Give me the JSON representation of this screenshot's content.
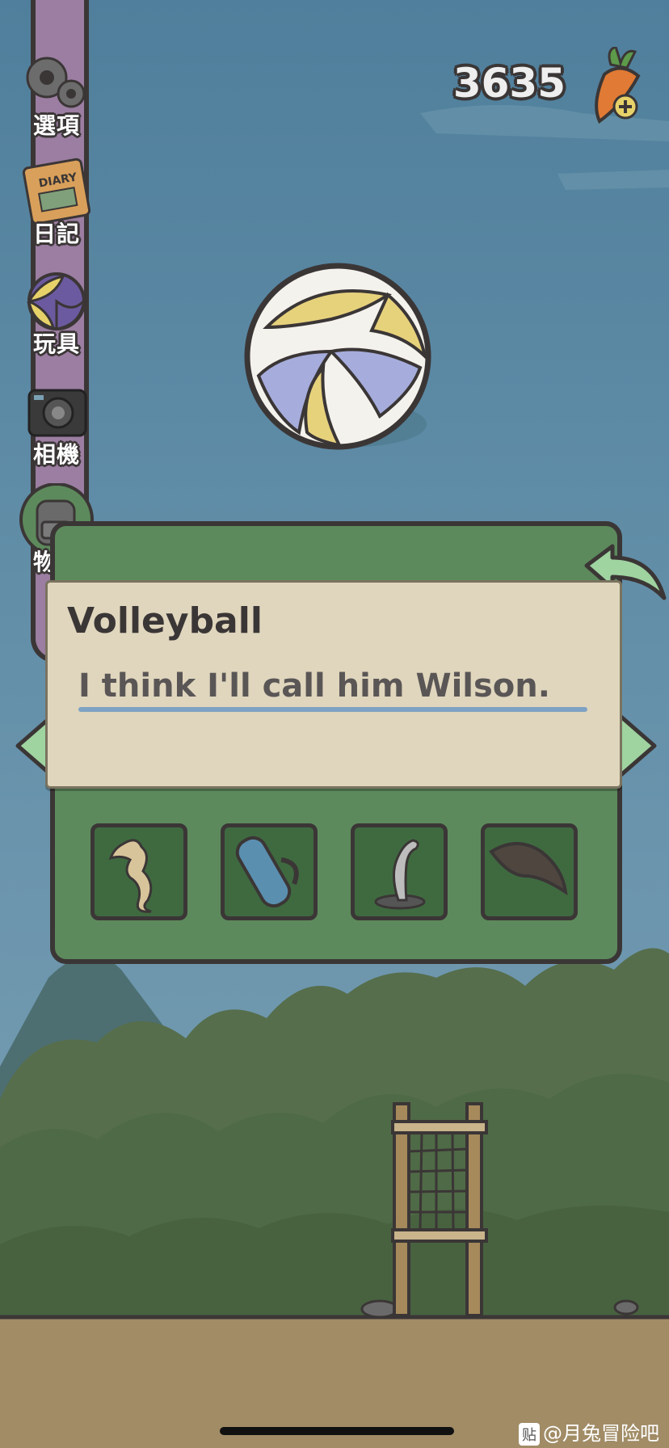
{
  "menu": {
    "items": [
      {
        "label": "選項",
        "icon": "gear-icon"
      },
      {
        "label": "日記",
        "icon": "diary-icon",
        "icon_text": "DIARY"
      },
      {
        "label": "玩具",
        "icon": "toys-icon"
      },
      {
        "label": "相機",
        "icon": "camera-icon"
      },
      {
        "label": "物品",
        "icon": "backpack-icon"
      }
    ]
  },
  "currency": {
    "amount": "3635",
    "icon": "carrot-plus-icon"
  },
  "featured_item": {
    "name": "Volleyball",
    "icon": "volleyball-icon"
  },
  "tooltip": {
    "title": "Volleyball",
    "description": "I think I'll call him Wilson."
  },
  "inventory": {
    "visible_row": [
      {
        "item": "seahorse-icon"
      },
      {
        "item": "yoga-mat-icon"
      },
      {
        "item": "eel-icon"
      },
      {
        "item": "moray-eel-icon"
      }
    ]
  },
  "watermark": {
    "badge": "贴",
    "text": "@月兔冒险吧"
  },
  "colors": {
    "sky": "#5f8aa4",
    "panel_green": "#5d8a5c",
    "slot_green": "#3f6a40",
    "menu_purple": "#9b7ea1",
    "tooltip_bg": "#e0d6bd",
    "outline": "#3b3636",
    "underline_blue": "#7ea2c3"
  }
}
